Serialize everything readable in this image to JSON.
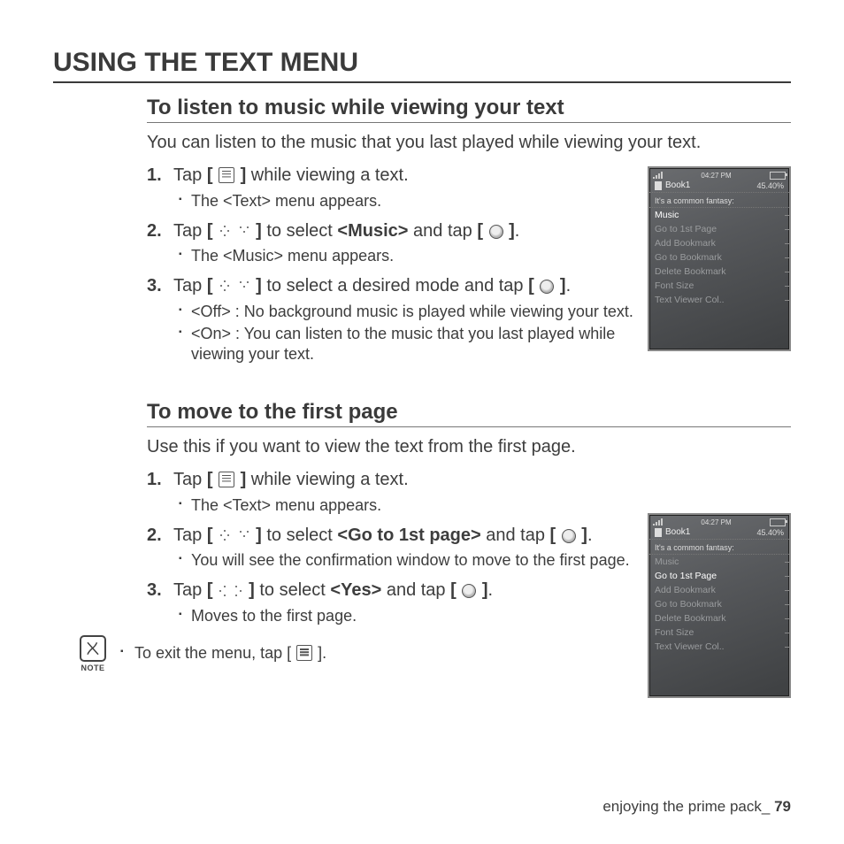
{
  "page": {
    "title": "USING THE TEXT MENU",
    "footer_text": "enjoying the prime pack_",
    "footer_page": "79"
  },
  "section1": {
    "heading": "To listen to music while viewing your text",
    "intro": "You can listen to the music that you last played while viewing your text.",
    "steps": [
      {
        "n": "1.",
        "pre": "Tap ",
        "post": " while viewing a text.",
        "sub": [
          "The <Text> menu appears."
        ]
      },
      {
        "n": "2.",
        "pre": "Tap ",
        "mid": " to select ",
        "bold": "<Music>",
        "mid2": " and tap ",
        "post": ".",
        "sub": [
          "The <Music> menu appears."
        ]
      },
      {
        "n": "3.",
        "pre": "Tap ",
        "mid": " to select a desired mode and tap ",
        "post": ".",
        "sub": [
          "<Off> : No background music is played while viewing your text.",
          "<On> : You can listen to the music that you last played while viewing your text."
        ]
      }
    ]
  },
  "section2": {
    "heading": "To move to the first page",
    "intro": "Use this if you want to view the text from the first page.",
    "steps": [
      {
        "n": "1.",
        "pre": "Tap ",
        "post": " while viewing a text.",
        "sub": [
          "The <Text> menu appears."
        ]
      },
      {
        "n": "2.",
        "pre": "Tap ",
        "mid": " to select ",
        "bold": "<Go to 1st page>",
        "mid2": " and tap ",
        "post": ".",
        "sub": [
          "You will see the confirmation window to move to the first page."
        ]
      },
      {
        "n": "3.",
        "pre": "Tap ",
        "mid": " to select ",
        "bold": "<Yes>",
        "mid2": " and tap ",
        "post": ".",
        "sub": [
          "Moves to the first page."
        ]
      }
    ]
  },
  "note": {
    "label": "NOTE",
    "text_pre": "To exit the menu, tap [ ",
    "text_post": " ]."
  },
  "device": {
    "time": "04:27 PM",
    "title": "Book1",
    "percent": "45.40%",
    "fantasy": "It's a common fantasy:",
    "menu": [
      "Music",
      "Go to 1st Page",
      "Add Bookmark",
      "Go to Bookmark",
      "Delete Bookmark",
      "Font Size",
      "Text Viewer Col.."
    ]
  }
}
